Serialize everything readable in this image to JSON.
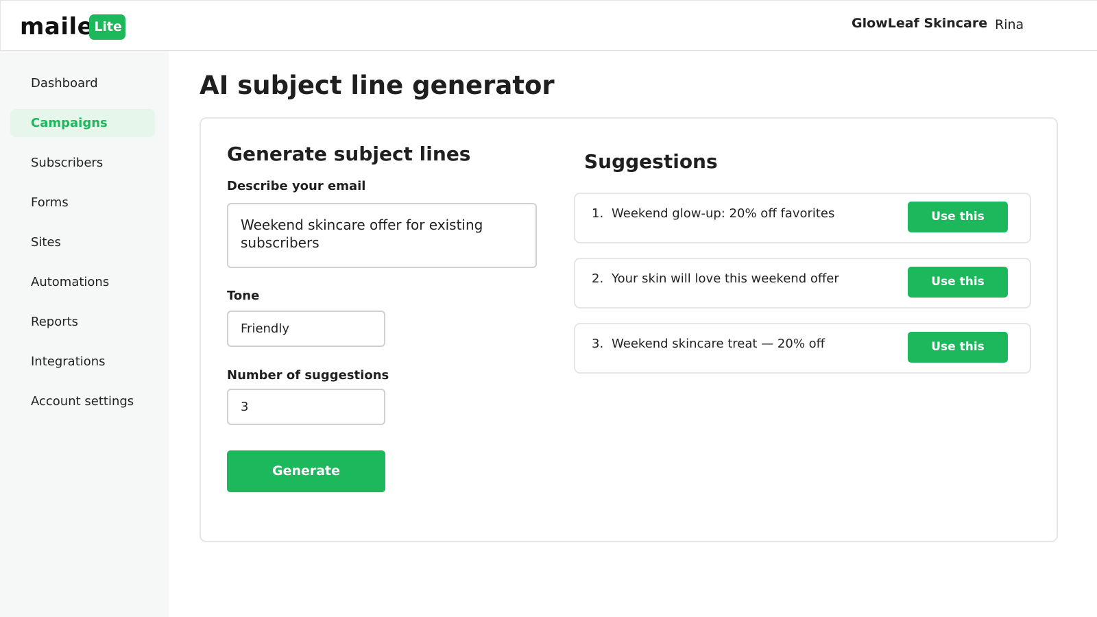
{
  "header": {
    "logo_word": "maile",
    "logo_badge": "Lite",
    "org_name": "GlowLeaf Skincare",
    "user_name": "Rina"
  },
  "sidebar": {
    "items": [
      {
        "label": "Dashboard",
        "active": false
      },
      {
        "label": "Campaigns",
        "active": true
      },
      {
        "label": "Subscribers",
        "active": false
      },
      {
        "label": "Forms",
        "active": false
      },
      {
        "label": "Sites",
        "active": false
      },
      {
        "label": "Automations",
        "active": false
      },
      {
        "label": "Reports",
        "active": false
      },
      {
        "label": "Integrations",
        "active": false
      },
      {
        "label": "Account settings",
        "active": false
      }
    ]
  },
  "main": {
    "page_title": "AI subject line generator",
    "generator": {
      "title": "Generate subject lines",
      "describe_label": "Describe your email",
      "describe_value": "Weekend skincare offer for existing subscribers",
      "tone_label": "Tone",
      "tone_value": "Friendly",
      "count_label": "Number of suggestions",
      "count_value": "3",
      "generate_label": "Generate"
    },
    "suggestions": {
      "title": "Suggestions",
      "items": [
        {
          "num": "1.",
          "text": "Weekend glow-up: 20% off favorites",
          "button": "Use this"
        },
        {
          "num": "2.",
          "text": "Your skin will love this weekend offer",
          "button": "Use this"
        },
        {
          "num": "3.",
          "text": "Weekend skincare treat — 20% off",
          "button": "Use this"
        }
      ]
    }
  },
  "colors": {
    "accent": "#1db75c",
    "active_nav_bg": "#e6f6eb",
    "sidebar_bg": "#f6f8f7"
  }
}
